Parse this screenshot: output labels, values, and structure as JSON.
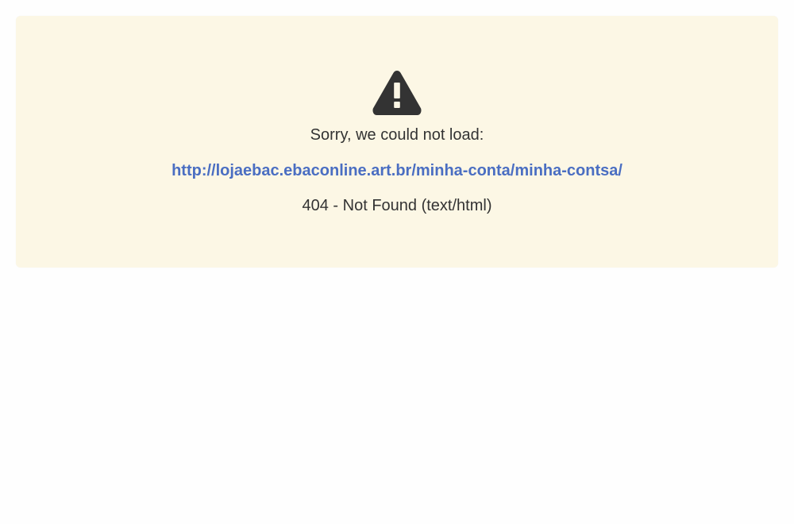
{
  "error": {
    "icon": "warning-icon",
    "message": "Sorry, we could not load:",
    "url": "http://lojaebac.ebaconline.art.br/minha-conta/minha-contsa/",
    "status": "404 - Not Found (text/html)"
  },
  "colors": {
    "panel_background": "#fcf7e5",
    "text": "#333333",
    "link": "#4a6ec2",
    "icon": "#333333"
  }
}
